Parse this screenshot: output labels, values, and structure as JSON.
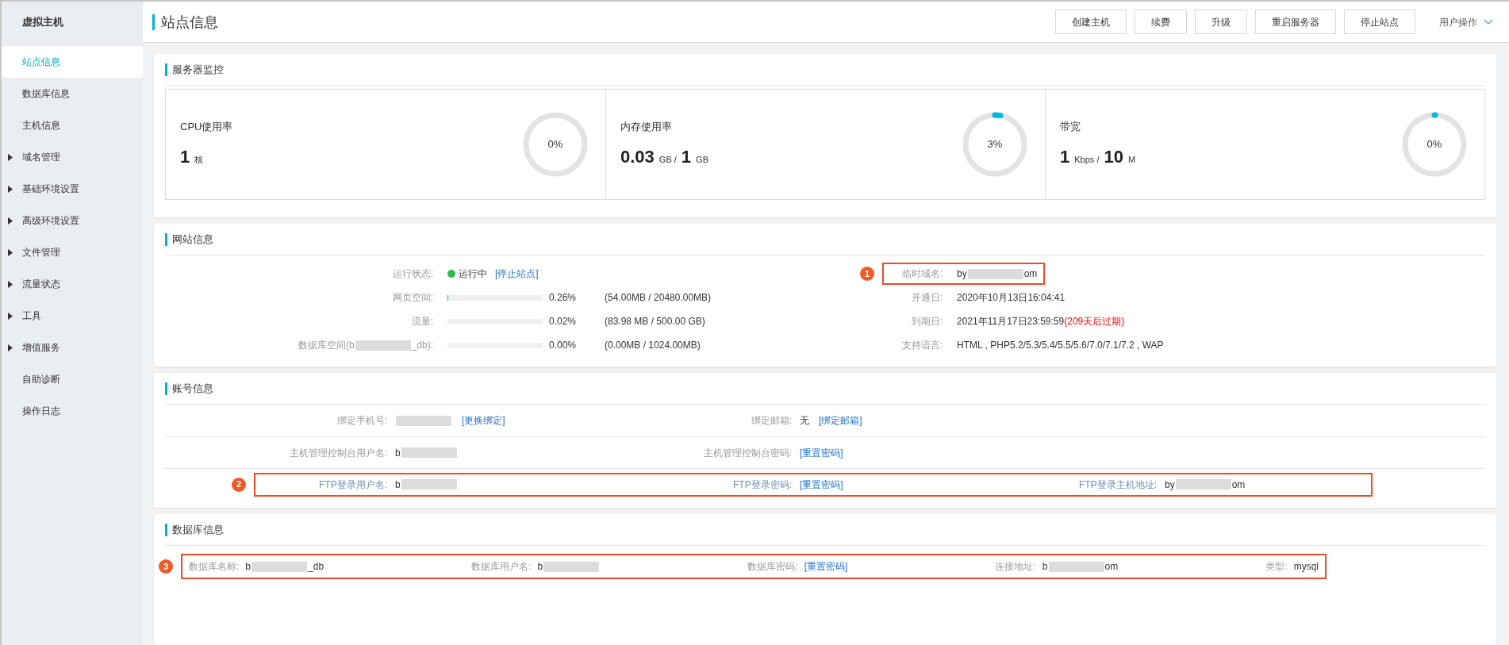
{
  "sidebar": {
    "title": "虚拟主机",
    "items": [
      {
        "label": "站点信息",
        "selected": true,
        "expandable": false
      },
      {
        "label": "数据库信息",
        "selected": false,
        "expandable": false
      },
      {
        "label": "主机信息",
        "selected": false,
        "expandable": false
      },
      {
        "label": "域名管理",
        "selected": false,
        "expandable": true
      },
      {
        "label": "基础环境设置",
        "selected": false,
        "expandable": true
      },
      {
        "label": "高级环境设置",
        "selected": false,
        "expandable": true
      },
      {
        "label": "文件管理",
        "selected": false,
        "expandable": true
      },
      {
        "label": "流量状态",
        "selected": false,
        "expandable": true
      },
      {
        "label": "工具",
        "selected": false,
        "expandable": true
      },
      {
        "label": "增值服务",
        "selected": false,
        "expandable": true
      },
      {
        "label": "自助诊断",
        "selected": false,
        "expandable": false
      },
      {
        "label": "操作日志",
        "selected": false,
        "expandable": false
      }
    ]
  },
  "header": {
    "title": "站点信息",
    "buttons": [
      "创建主机",
      "续费",
      "升级",
      "重启服务器",
      "停止站点"
    ],
    "user_menu": "用户操作"
  },
  "monitor": {
    "title": "服务器监控",
    "cards": [
      {
        "label": "CPU使用率",
        "parts": [
          {
            "kind": "big",
            "text": "1"
          },
          {
            "kind": "unit",
            "text": "核"
          }
        ],
        "gauge": "0%"
      },
      {
        "label": "内存使用率",
        "parts": [
          {
            "kind": "big",
            "text": "0.03"
          },
          {
            "kind": "unit",
            "text": "GB /"
          },
          {
            "kind": "big",
            "text": "1"
          },
          {
            "kind": "unit",
            "text": "GB"
          }
        ],
        "gauge": "3%",
        "level": 0.03
      },
      {
        "label": "带宽",
        "parts": [
          {
            "kind": "big",
            "text": "1"
          },
          {
            "kind": "unit",
            "text": "Kbps /"
          },
          {
            "kind": "big",
            "text": "10"
          },
          {
            "kind": "unit",
            "text": "M"
          }
        ],
        "gauge": "0%",
        "level": 0.005
      }
    ]
  },
  "website": {
    "title": "网站信息",
    "left": [
      {
        "kind": "status",
        "label": [
          {
            "kind": "text",
            "text": "运行状态:"
          }
        ],
        "status": "运行中",
        "color": "#2eb84b",
        "link": "[停止站点]"
      },
      {
        "kind": "usage",
        "label": [
          {
            "kind": "text",
            "text": "网页空间:"
          }
        ],
        "level": 0.0026,
        "percent": "0.26%",
        "detail": "(54.00MB / 20480.00MB)"
      },
      {
        "kind": "usage",
        "label": [
          {
            "kind": "text",
            "text": "流量:"
          }
        ],
        "level": 0.0002,
        "percent": "0.02%",
        "detail": "(83.98 MB / 500.00 GB)"
      },
      {
        "kind": "usage",
        "label": [
          {
            "kind": "text",
            "text": "数据库空间(b"
          },
          {
            "kind": "blur"
          },
          {
            "kind": "text",
            "text": "_db):"
          }
        ],
        "percent": "0.00%",
        "detail": "(0.00MB / 1024.00MB)"
      }
    ],
    "right": [
      {
        "label": "临时域名:",
        "value": [
          {
            "kind": "text",
            "text": "by"
          },
          {
            "kind": "blur"
          },
          {
            "kind": "text",
            "text": "om"
          }
        ],
        "annotation": "1"
      },
      {
        "label": "开通日:",
        "value": [
          {
            "kind": "text",
            "text": "2020年10月13日16:04:41"
          }
        ]
      },
      {
        "label": "到期日:",
        "value": [
          {
            "kind": "text",
            "text": "2021年11月17日23:59:59"
          }
        ],
        "note": "(209天后过期)"
      },
      {
        "label": "支持语言:",
        "value": [
          {
            "kind": "text",
            "text": "HTML , PHP5.2/5.3/5.4/5.5/5.6/7.0/7.1/7.2 , WAP"
          }
        ]
      }
    ]
  },
  "account": {
    "title": "账号信息",
    "rows": [
      {
        "cells": [
          {
            "label": "绑定手机号:",
            "value": [
              {
                "kind": "blur"
              }
            ],
            "link": "[更换绑定]"
          },
          {
            "label": "绑定邮箱:",
            "value": [
              {
                "kind": "text",
                "text": "无"
              }
            ],
            "link": "[绑定邮箱]"
          }
        ]
      },
      {
        "cells": [
          {
            "label": "主机管理控制台用户名:",
            "value": [
              {
                "kind": "text",
                "text": "b"
              },
              {
                "kind": "blur"
              }
            ]
          },
          {
            "label": "主机管理控制台密码:",
            "link": "[重置密码]"
          }
        ]
      },
      {
        "annotation": "2",
        "cells": [
          {
            "label": "FTP登录用户名:",
            "value": [
              {
                "kind": "text",
                "text": "b"
              },
              {
                "kind": "blur"
              }
            ]
          },
          {
            "label": "FTP登录密码:",
            "link": "[重置密码]"
          },
          {
            "label": "FTP登录主机地址:",
            "value": [
              {
                "kind": "text",
                "text": "by"
              },
              {
                "kind": "blur"
              },
              {
                "kind": "text",
                "text": "om"
              }
            ]
          }
        ]
      }
    ]
  },
  "database": {
    "title": "数据库信息",
    "annotation": "3",
    "cells": [
      {
        "label": "数据库名称:",
        "value": [
          {
            "kind": "text",
            "text": "b"
          },
          {
            "kind": "blur"
          },
          {
            "kind": "text",
            "text": "_db"
          }
        ]
      },
      {
        "label": "数据库用户名:",
        "value": [
          {
            "kind": "text",
            "text": "b"
          },
          {
            "kind": "blur"
          }
        ]
      },
      {
        "label": "数据库密码:",
        "link": "[重置密码]"
      },
      {
        "label": "连接地址:",
        "value": [
          {
            "kind": "text",
            "text": "b"
          },
          {
            "kind": "blur"
          },
          {
            "kind": "text",
            "text": "om"
          }
        ]
      },
      {
        "label": "类型:",
        "value": [
          {
            "kind": "text",
            "text": "mysql"
          }
        ]
      }
    ]
  }
}
